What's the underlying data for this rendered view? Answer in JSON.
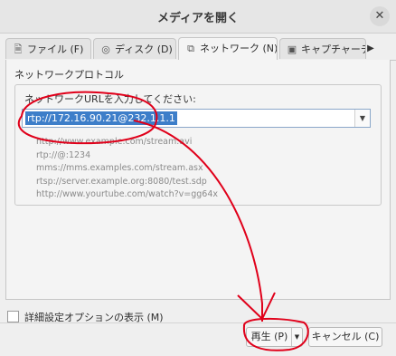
{
  "dialog": {
    "title": "メディアを開く",
    "close_glyph": "✕"
  },
  "tabs": [
    {
      "label": "ファイル (F)",
      "icon": "file-icon"
    },
    {
      "label": "ディスク (D)",
      "icon": "disc-icon"
    },
    {
      "label": "ネットワーク (N)",
      "icon": "network-icon",
      "active": true
    },
    {
      "label": "キャプチャーデ",
      "icon": "capture-icon"
    }
  ],
  "tab_scroll_glyph": "▶",
  "network": {
    "section_label": "ネットワークプロトコル",
    "url_label": "ネットワークURLを入力してください:",
    "url_value": "rtp://172.16.90.21@232.1.1.1",
    "examples": [
      "http://www.example.com/stream.avi",
      "rtp://@:1234",
      "mms://mms.examples.com/stream.asx",
      "rtsp://server.example.org:8080/test.sdp",
      "http://www.yourtube.com/watch?v=gg64x"
    ]
  },
  "advanced_options_label": "詳細設定オプションの表示 (M)",
  "buttons": {
    "play": "再生 (P)",
    "cancel": "キャンセル (C)"
  },
  "annotation_color": "#e0001a"
}
